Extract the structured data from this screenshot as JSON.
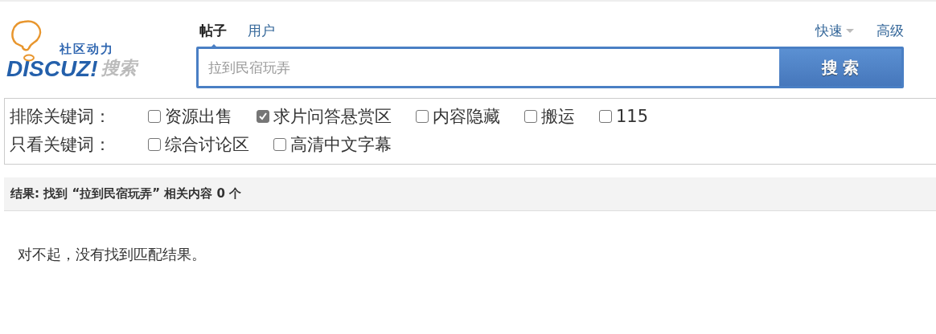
{
  "logo": {
    "tagline": "社区动力",
    "brand": "DISCUZ!",
    "suffix": "搜索"
  },
  "tabs": [
    {
      "label": "帖子",
      "selected": true
    },
    {
      "label": "用户",
      "selected": false
    }
  ],
  "links": [
    {
      "label": "快速",
      "kind": "dropdown"
    },
    {
      "label": "高级",
      "kind": "link"
    }
  ],
  "search": {
    "value": "拉到民宿玩弄",
    "button": "搜 索"
  },
  "filters": [
    {
      "label": "排除关键词：",
      "options": [
        {
          "label": "资源出售",
          "checked": false
        },
        {
          "label": "求片问答悬赏区",
          "checked": true
        },
        {
          "label": "内容隐藏",
          "checked": false
        },
        {
          "label": "搬运",
          "checked": false
        },
        {
          "label": "115",
          "checked": false
        }
      ]
    },
    {
      "label": "只看关键词：",
      "options": [
        {
          "label": "综合讨论区",
          "checked": false
        },
        {
          "label": "高清中文字幕",
          "checked": false
        }
      ]
    }
  ],
  "result": "结果: 找到 “拉到民宿玩弄” 相关内容 0 个",
  "message": "对不起，没有找到匹配结果。"
}
